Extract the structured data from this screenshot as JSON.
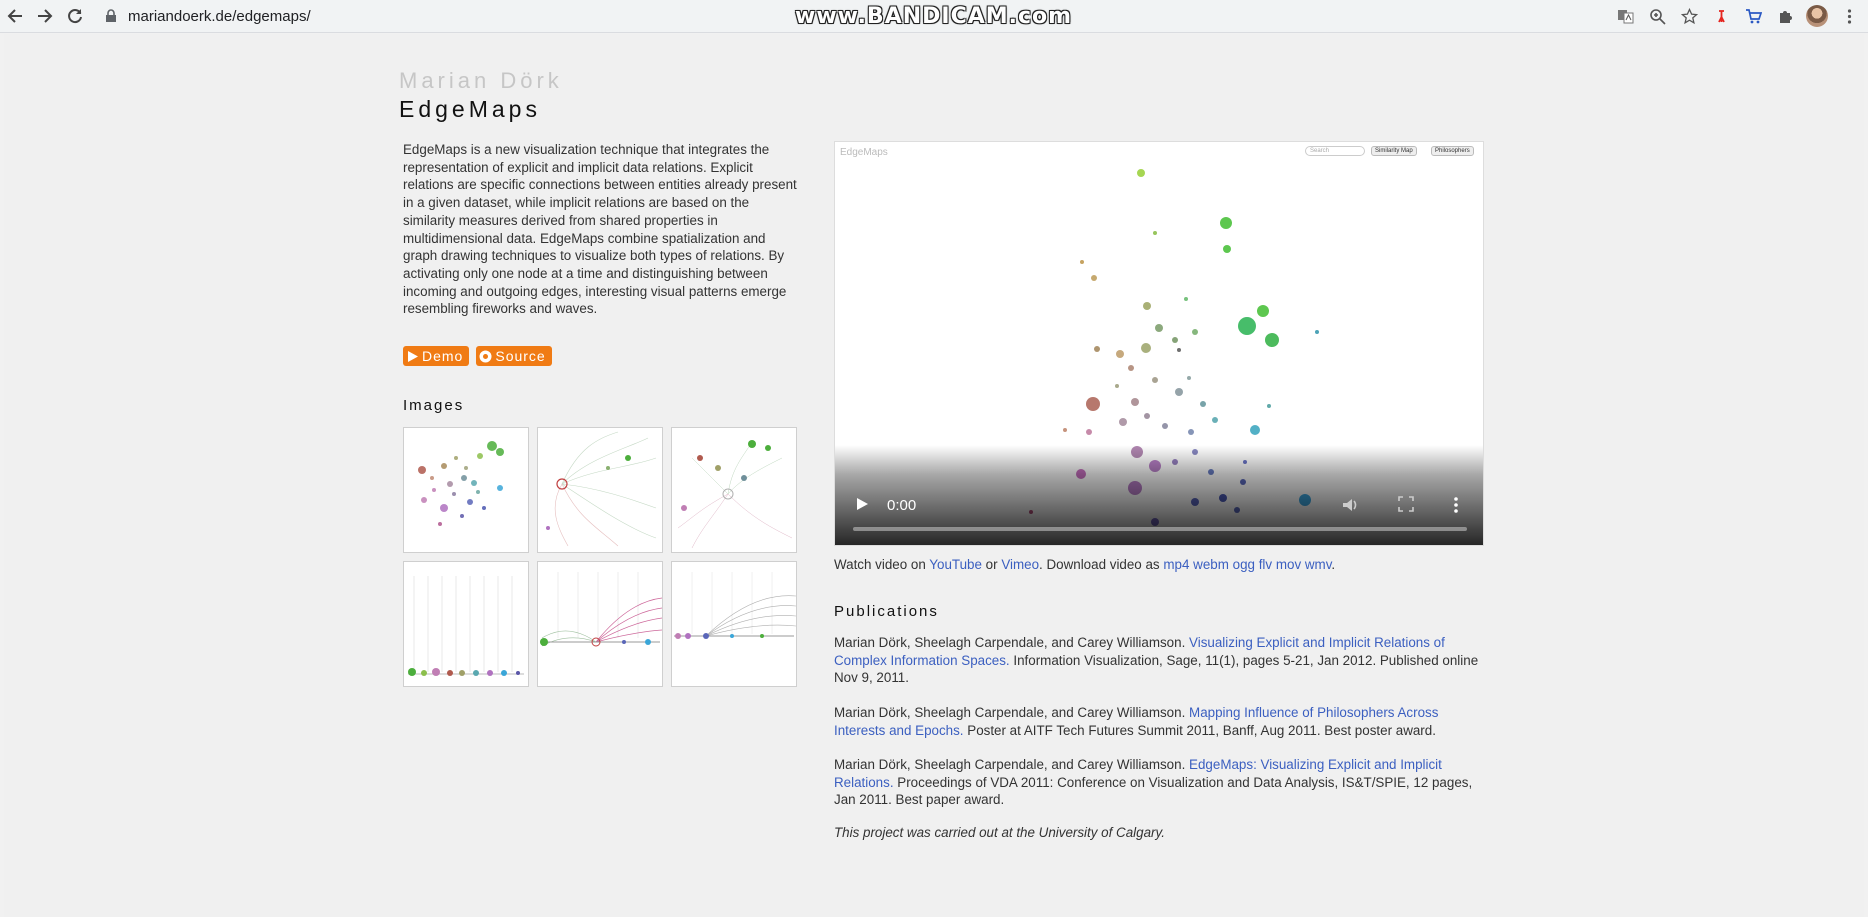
{
  "browser": {
    "url": "mariandoerk.de/edgemaps/",
    "watermark": "www.BANDICAM.com"
  },
  "header": {
    "author": "Marian Dörk",
    "title": "EdgeMaps"
  },
  "description": "EdgeMaps is a new visualization technique that integrates the representation of explicit and implicit data relations. Explicit relations are specific connections between entities already present in a given dataset, while implicit relations are based on the similarity measures derived from shared properties in multidimensional data. EdgeMaps combine spatialization and graph drawing techniques to visualize both types of relations. By activating only one node at a time and distinguishing between incoming and outgoing edges, interesting visual patterns emerge resembling fireworks and waves.",
  "buttons": {
    "demo": "Demo",
    "source": "Source"
  },
  "images": {
    "heading": "Images"
  },
  "video": {
    "brand": "EdgeMaps",
    "search_placeholder": "Search",
    "select1": "Similarity Map",
    "select2": "Philosophers",
    "time": "0:00",
    "progress": 0
  },
  "video_links": {
    "watch_prefix": "Watch video on",
    "youtube": "YouTube",
    "or": "or",
    "vimeo": "Vimeo",
    "download_prefix": ". Download video as",
    "formats": [
      "mp4",
      "webm",
      "ogg",
      "flv",
      "mov",
      "wmv"
    ],
    "suffix": "."
  },
  "publications": {
    "heading": "Publications",
    "items": [
      {
        "authors": "Marian Dörk, Sheelagh Carpendale, and Carey Williamson.",
        "title": "Visualizing Explicit and Implicit Relations of Complex Information Spaces.",
        "venue": "Information Visualization, Sage, 11(1), pages 5-21, Jan 2012. Published online Nov 9, 2011."
      },
      {
        "authors": "Marian Dörk, Sheelagh Carpendale, and Carey Williamson.",
        "title": "Mapping Influence of Philosophers Across Interests and Epochs.",
        "venue": "Poster at AITF Tech Futures Summit 2011, Banff, Aug 2011. Best poster award."
      },
      {
        "authors": "Marian Dörk, Sheelagh Carpendale, and Carey Williamson.",
        "title": "EdgeMaps: Visualizing Explicit and Implicit Relations.",
        "venue": "Proceedings of VDA 2011: Conference on Visualization and Data Analysis, IS&T/SPIE, 12 pages, Jan 2011. Best paper award."
      }
    ],
    "note": "This project was carried out at the University of Calgary."
  },
  "colors": {
    "accent": "#f07b14",
    "link": "#3b5fc0"
  }
}
